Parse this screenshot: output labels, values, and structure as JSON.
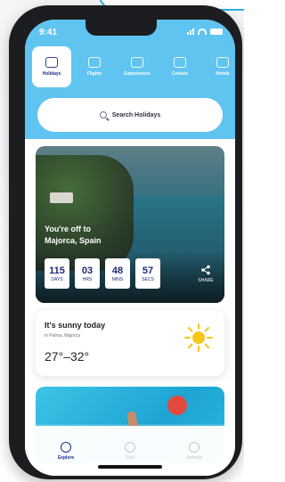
{
  "status_bar": {
    "time": "9:41"
  },
  "tabs": [
    {
      "label": "Holidays",
      "icon": "holiday-icon",
      "active": true
    },
    {
      "label": "Flights",
      "icon": "plane-icon",
      "active": false
    },
    {
      "label": "Experiences",
      "icon": "camera-icon",
      "active": false
    },
    {
      "label": "Cruises",
      "icon": "ship-icon",
      "active": false
    },
    {
      "label": "Hotels",
      "icon": "hotel-icon",
      "active": false
    }
  ],
  "search": {
    "placeholder": "Search Holidays"
  },
  "hero": {
    "line1": "You're off to",
    "line2": "Majorca, Spain",
    "countdown": [
      {
        "value": "115",
        "unit": "DAYS"
      },
      {
        "value": "03",
        "unit": "HRS"
      },
      {
        "value": "48",
        "unit": "MINS"
      },
      {
        "value": "57",
        "unit": "SECS"
      }
    ],
    "share_label": "SHARE"
  },
  "weather": {
    "heading": "It's sunny today",
    "location": "in Palma, Majorca",
    "temp_range": "27°–32°"
  },
  "nav": [
    {
      "label": "Explore",
      "icon": "search-icon",
      "active": true
    },
    {
      "label": "Trips",
      "icon": "tag-icon",
      "active": false
    },
    {
      "label": "Settings",
      "icon": "gear-icon",
      "active": false
    }
  ],
  "colors": {
    "sky": "#60c4f1",
    "navy": "#1e2b8a",
    "muted": "#c4c7ce"
  }
}
